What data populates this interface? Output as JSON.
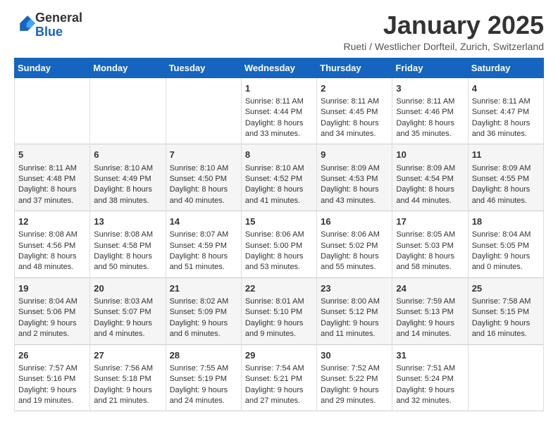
{
  "header": {
    "logo_general": "General",
    "logo_blue": "Blue",
    "month_title": "January 2025",
    "location": "Rueti / Westlicher Dorfteil, Zurich, Switzerland"
  },
  "days_of_week": [
    "Sunday",
    "Monday",
    "Tuesday",
    "Wednesday",
    "Thursday",
    "Friday",
    "Saturday"
  ],
  "weeks": [
    [
      {
        "day": "",
        "info": ""
      },
      {
        "day": "",
        "info": ""
      },
      {
        "day": "",
        "info": ""
      },
      {
        "day": "1",
        "info": "Sunrise: 8:11 AM\nSunset: 4:44 PM\nDaylight: 8 hours and 33 minutes."
      },
      {
        "day": "2",
        "info": "Sunrise: 8:11 AM\nSunset: 4:45 PM\nDaylight: 8 hours and 34 minutes."
      },
      {
        "day": "3",
        "info": "Sunrise: 8:11 AM\nSunset: 4:46 PM\nDaylight: 8 hours and 35 minutes."
      },
      {
        "day": "4",
        "info": "Sunrise: 8:11 AM\nSunset: 4:47 PM\nDaylight: 8 hours and 36 minutes."
      }
    ],
    [
      {
        "day": "5",
        "info": "Sunrise: 8:11 AM\nSunset: 4:48 PM\nDaylight: 8 hours and 37 minutes."
      },
      {
        "day": "6",
        "info": "Sunrise: 8:10 AM\nSunset: 4:49 PM\nDaylight: 8 hours and 38 minutes."
      },
      {
        "day": "7",
        "info": "Sunrise: 8:10 AM\nSunset: 4:50 PM\nDaylight: 8 hours and 40 minutes."
      },
      {
        "day": "8",
        "info": "Sunrise: 8:10 AM\nSunset: 4:52 PM\nDaylight: 8 hours and 41 minutes."
      },
      {
        "day": "9",
        "info": "Sunrise: 8:09 AM\nSunset: 4:53 PM\nDaylight: 8 hours and 43 minutes."
      },
      {
        "day": "10",
        "info": "Sunrise: 8:09 AM\nSunset: 4:54 PM\nDaylight: 8 hours and 44 minutes."
      },
      {
        "day": "11",
        "info": "Sunrise: 8:09 AM\nSunset: 4:55 PM\nDaylight: 8 hours and 46 minutes."
      }
    ],
    [
      {
        "day": "12",
        "info": "Sunrise: 8:08 AM\nSunset: 4:56 PM\nDaylight: 8 hours and 48 minutes."
      },
      {
        "day": "13",
        "info": "Sunrise: 8:08 AM\nSunset: 4:58 PM\nDaylight: 8 hours and 50 minutes."
      },
      {
        "day": "14",
        "info": "Sunrise: 8:07 AM\nSunset: 4:59 PM\nDaylight: 8 hours and 51 minutes."
      },
      {
        "day": "15",
        "info": "Sunrise: 8:06 AM\nSunset: 5:00 PM\nDaylight: 8 hours and 53 minutes."
      },
      {
        "day": "16",
        "info": "Sunrise: 8:06 AM\nSunset: 5:02 PM\nDaylight: 8 hours and 55 minutes."
      },
      {
        "day": "17",
        "info": "Sunrise: 8:05 AM\nSunset: 5:03 PM\nDaylight: 8 hours and 58 minutes."
      },
      {
        "day": "18",
        "info": "Sunrise: 8:04 AM\nSunset: 5:05 PM\nDaylight: 9 hours and 0 minutes."
      }
    ],
    [
      {
        "day": "19",
        "info": "Sunrise: 8:04 AM\nSunset: 5:06 PM\nDaylight: 9 hours and 2 minutes."
      },
      {
        "day": "20",
        "info": "Sunrise: 8:03 AM\nSunset: 5:07 PM\nDaylight: 9 hours and 4 minutes."
      },
      {
        "day": "21",
        "info": "Sunrise: 8:02 AM\nSunset: 5:09 PM\nDaylight: 9 hours and 6 minutes."
      },
      {
        "day": "22",
        "info": "Sunrise: 8:01 AM\nSunset: 5:10 PM\nDaylight: 9 hours and 9 minutes."
      },
      {
        "day": "23",
        "info": "Sunrise: 8:00 AM\nSunset: 5:12 PM\nDaylight: 9 hours and 11 minutes."
      },
      {
        "day": "24",
        "info": "Sunrise: 7:59 AM\nSunset: 5:13 PM\nDaylight: 9 hours and 14 minutes."
      },
      {
        "day": "25",
        "info": "Sunrise: 7:58 AM\nSunset: 5:15 PM\nDaylight: 9 hours and 16 minutes."
      }
    ],
    [
      {
        "day": "26",
        "info": "Sunrise: 7:57 AM\nSunset: 5:16 PM\nDaylight: 9 hours and 19 minutes."
      },
      {
        "day": "27",
        "info": "Sunrise: 7:56 AM\nSunset: 5:18 PM\nDaylight: 9 hours and 21 minutes."
      },
      {
        "day": "28",
        "info": "Sunrise: 7:55 AM\nSunset: 5:19 PM\nDaylight: 9 hours and 24 minutes."
      },
      {
        "day": "29",
        "info": "Sunrise: 7:54 AM\nSunset: 5:21 PM\nDaylight: 9 hours and 27 minutes."
      },
      {
        "day": "30",
        "info": "Sunrise: 7:52 AM\nSunset: 5:22 PM\nDaylight: 9 hours and 29 minutes."
      },
      {
        "day": "31",
        "info": "Sunrise: 7:51 AM\nSunset: 5:24 PM\nDaylight: 9 hours and 32 minutes."
      },
      {
        "day": "",
        "info": ""
      }
    ]
  ]
}
